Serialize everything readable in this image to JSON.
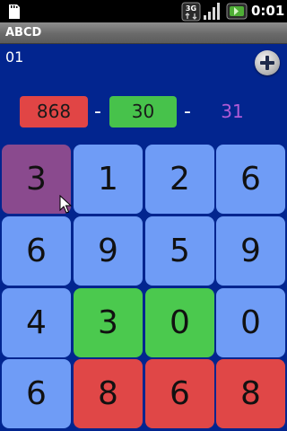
{
  "status_bar": {
    "time": "0:01",
    "network_badge": "3G",
    "icons": [
      "sd-card-icon",
      "network-3g-icon",
      "signal-icon",
      "battery-icon"
    ]
  },
  "app": {
    "title": "ABCD"
  },
  "header": {
    "level": "01",
    "add_button_icon": "plus-icon"
  },
  "equation": {
    "operand_a": "868",
    "operator_1": "-",
    "operand_b": "30",
    "operator_2": "-",
    "result": "31"
  },
  "grid": {
    "rows": [
      [
        "3",
        "1",
        "2",
        "6"
      ],
      [
        "6",
        "9",
        "5",
        "9"
      ],
      [
        "4",
        "3",
        "0",
        "0"
      ],
      [
        "6",
        "8",
        "6",
        "8"
      ]
    ],
    "colors": [
      [
        "purple",
        "blue",
        "blue",
        "blue"
      ],
      [
        "blue",
        "blue",
        "blue",
        "blue"
      ],
      [
        "blue",
        "green",
        "green",
        "blue"
      ],
      [
        "blue",
        "red",
        "red",
        "red"
      ]
    ]
  },
  "palette": {
    "background": "#02258f",
    "tile_blue": "#6f9cf6",
    "tile_purple": "#8a4a8e",
    "tile_green": "#4bc94e",
    "tile_red": "#e04747",
    "result_purple": "#b15bd6"
  }
}
